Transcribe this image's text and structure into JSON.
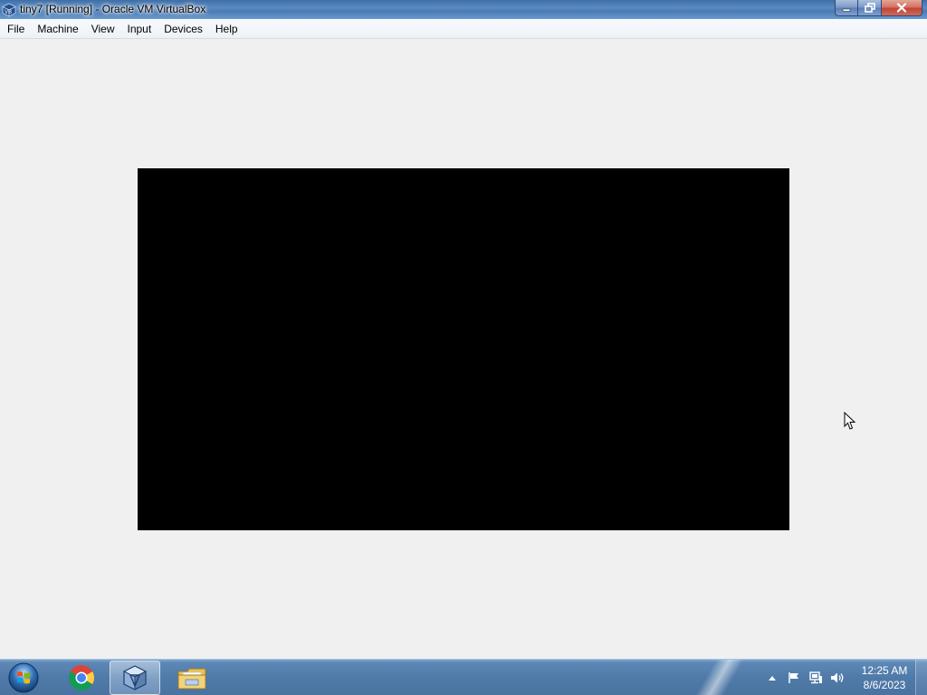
{
  "window": {
    "title": "tiny7 [Running] - Oracle VM VirtualBox",
    "app_icon": "virtualbox-icon",
    "controls": {
      "minimize_icon": "minimize-icon",
      "maximize_icon": "restore-icon",
      "close_icon": "close-icon"
    }
  },
  "menubar": {
    "items": [
      {
        "label": "File"
      },
      {
        "label": "Machine"
      },
      {
        "label": "View"
      },
      {
        "label": "Input"
      },
      {
        "label": "Devices"
      },
      {
        "label": "Help"
      }
    ]
  },
  "vm_display": {
    "screen_color": "#000000",
    "background_color": "#f0f0f0"
  },
  "taskbar": {
    "start_icon": "windows-start-orb-icon",
    "pinned": [
      {
        "icon": "chrome-icon",
        "active": false
      },
      {
        "icon": "virtualbox-icon",
        "active": true
      },
      {
        "icon": "file-explorer-icon",
        "active": false
      }
    ],
    "tray": {
      "icons": [
        "show-hidden-icons-arrow",
        "action-center-flag-icon",
        "network-icon",
        "volume-icon"
      ],
      "time": "12:25 AM",
      "date": "8/6/2023"
    }
  }
}
